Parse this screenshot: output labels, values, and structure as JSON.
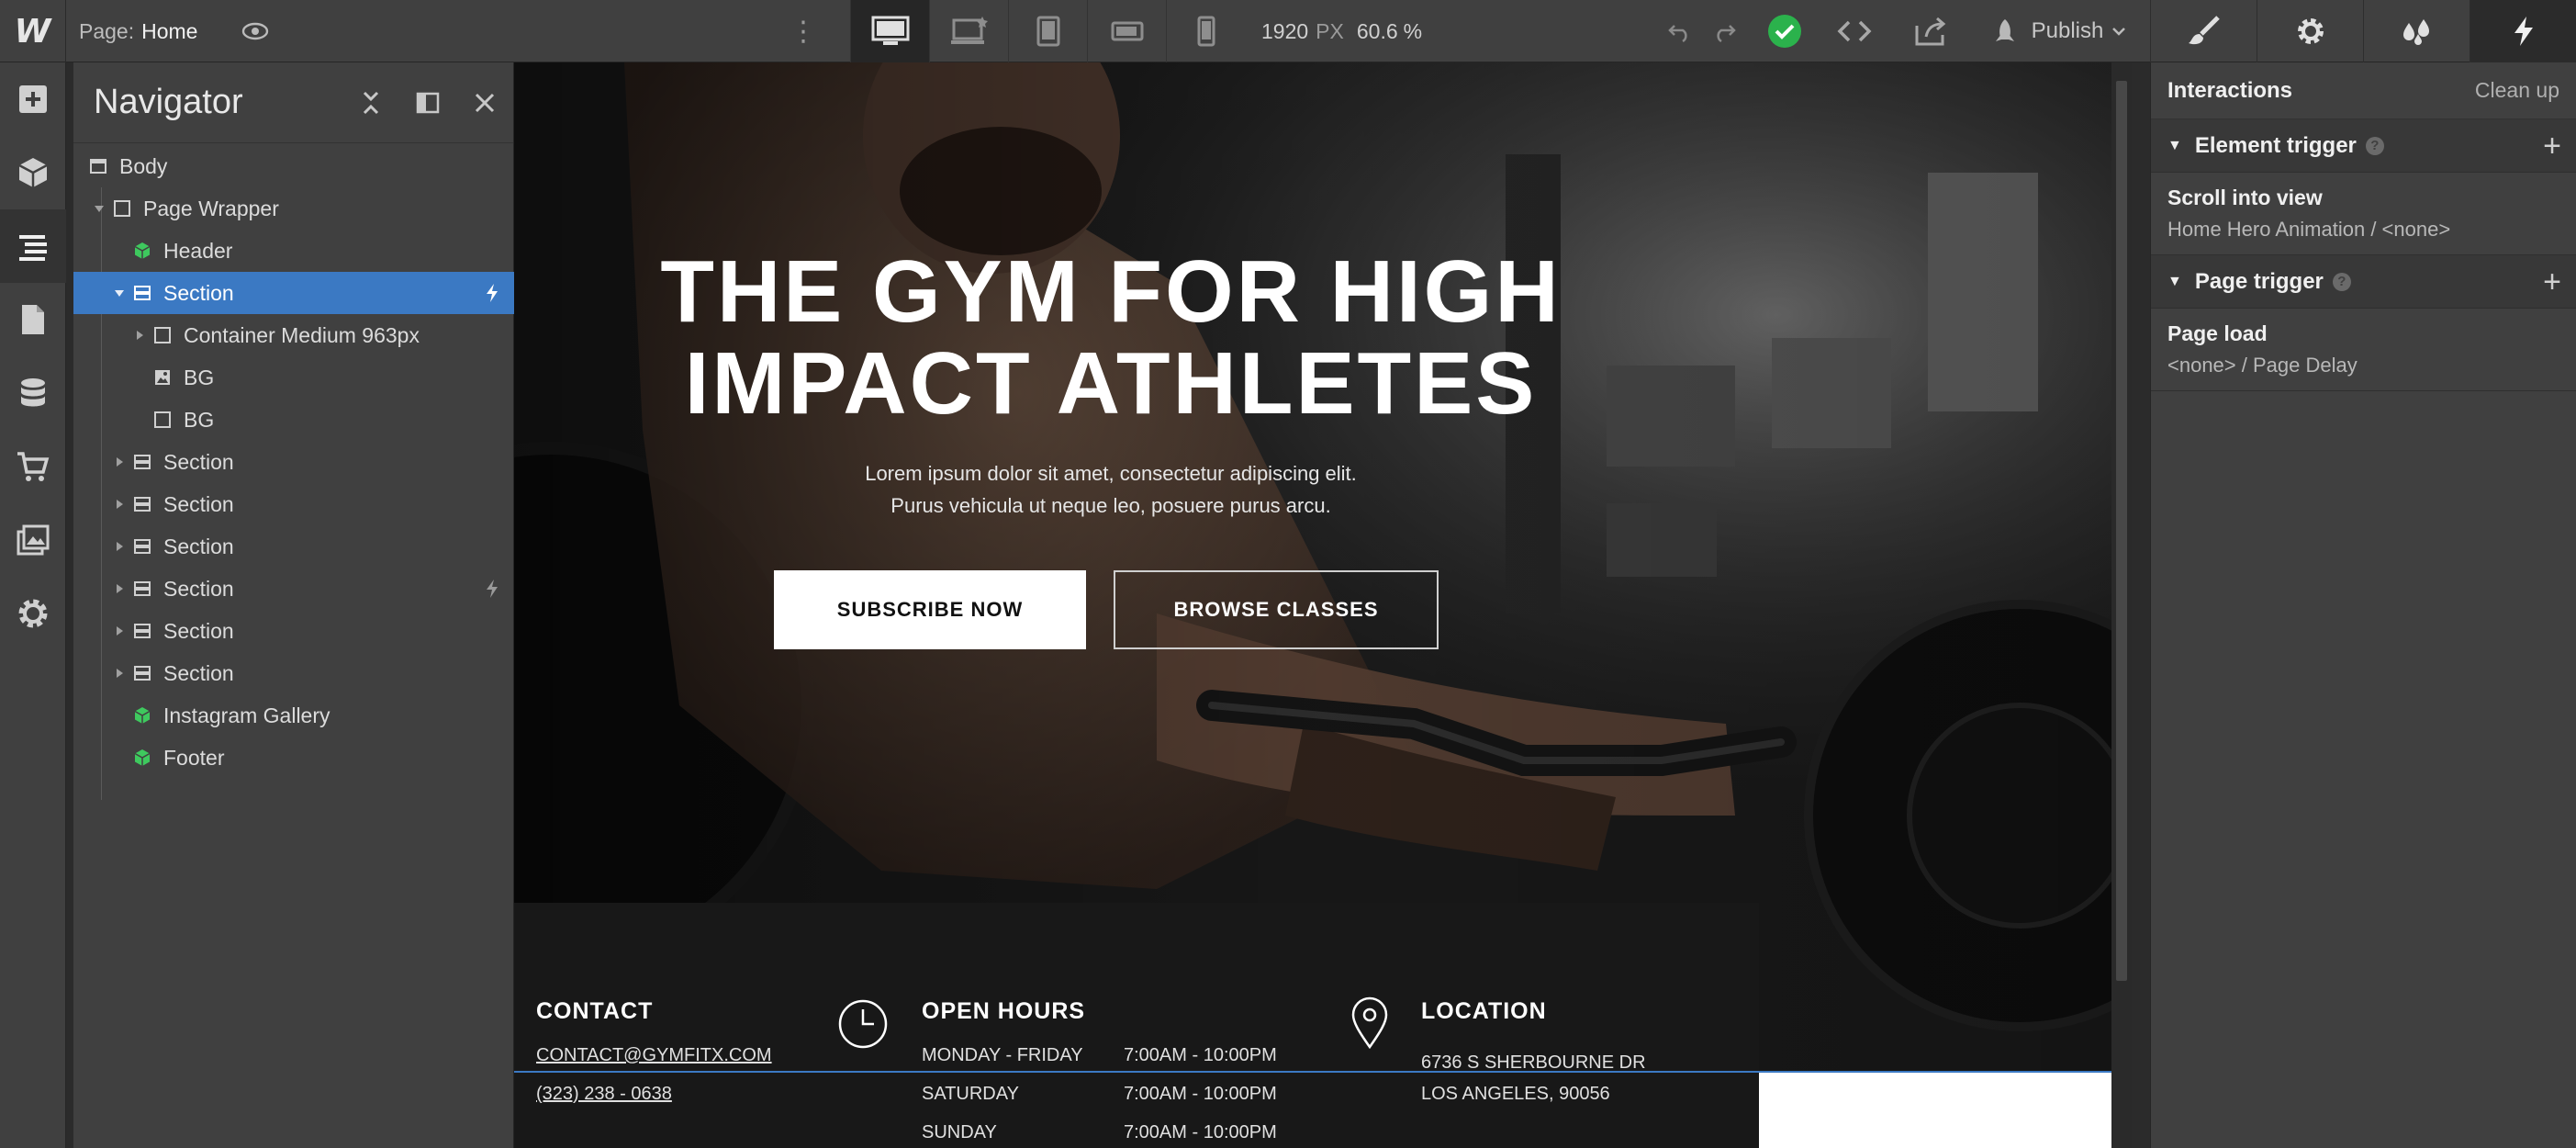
{
  "topbar": {
    "logo": "W",
    "page_prefix": "Page:",
    "page_name": "Home",
    "width_value": "1920",
    "width_unit": "PX",
    "zoom_value": "60.6",
    "zoom_unit": "%",
    "publish_label": "Publish",
    "breakpoint_icons": [
      "desktop-icon",
      "large-desktop-icon",
      "tablet-icon",
      "mobile-landscape-icon",
      "mobile-portrait-icon"
    ],
    "right_tabs": [
      "style-brush-icon",
      "settings-gear-icon",
      "style-manager-drops-icon",
      "interactions-bolt-icon"
    ]
  },
  "rail": [
    "add-icon",
    "symbols-cube-icon",
    "navigator-icon",
    "pages-icon",
    "cms-database-icon",
    "ecommerce-cart-icon",
    "assets-images-icon",
    "project-settings-gear-icon"
  ],
  "navigator": {
    "title": "Navigator",
    "nodes": [
      {
        "label": "Body"
      },
      {
        "label": "Page Wrapper"
      },
      {
        "label": "Header"
      },
      {
        "label": "Section"
      },
      {
        "label": "Container Medium 963px"
      },
      {
        "label": "BG"
      },
      {
        "label": "BG"
      },
      {
        "label": "Section"
      },
      {
        "label": "Section"
      },
      {
        "label": "Section"
      },
      {
        "label": "Section"
      },
      {
        "label": "Section"
      },
      {
        "label": "Section"
      },
      {
        "label": "Instagram Gallery"
      },
      {
        "label": "Footer"
      }
    ]
  },
  "canvas": {
    "hero_title_line1": "THE GYM FOR HIGH",
    "hero_title_line2": "IMPACT ATHLETES",
    "hero_sub_line1": "Lorem ipsum dolor sit amet, consectetur adipiscing elit.",
    "hero_sub_line2": "Purus vehicula ut neque leo, posuere purus arcu.",
    "subscribe_label": "SUBSCRIBE NOW",
    "browse_label": "BROWSE CLASSES",
    "contact": {
      "heading": "CONTACT",
      "email": "CONTACT@GYMFITX.COM",
      "phone": "(323) 238 - 0638"
    },
    "hours": {
      "heading": "OPEN HOURS",
      "rows": [
        {
          "day": "MONDAY - FRIDAY",
          "time": "7:00AM - 10:00PM"
        },
        {
          "day": "SATURDAY",
          "time": "7:00AM - 10:00PM"
        },
        {
          "day": "SUNDAY",
          "time": "7:00AM - 10:00PM"
        }
      ]
    },
    "location": {
      "heading": "LOCATION",
      "line1": "6736 S SHERBOURNE DR",
      "line2": "LOS ANGELES, 90056"
    }
  },
  "interactions": {
    "title": "Interactions",
    "clean_up": "Clean up",
    "element_trigger": {
      "heading": "Element trigger",
      "name": "Scroll into view",
      "desc": "Home Hero Animation / <none>"
    },
    "page_trigger": {
      "heading": "Page trigger",
      "name": "Page load",
      "desc": "<none> / Page Delay"
    }
  },
  "colors": {
    "selection": "#3b79c3",
    "success": "#2bb24c",
    "symbol_green": "#3ec95e"
  }
}
